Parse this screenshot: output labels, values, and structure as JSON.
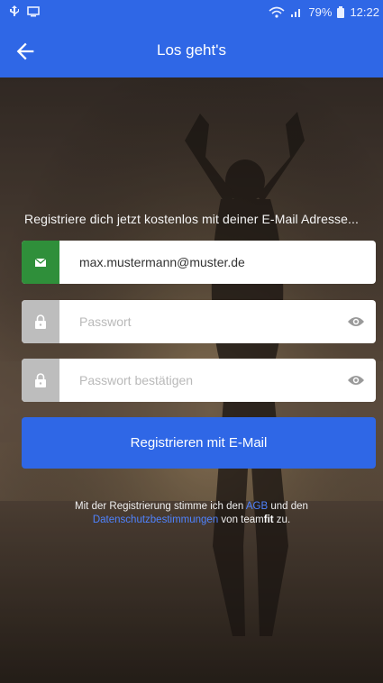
{
  "status_bar": {
    "battery": "79%",
    "time": "12:22"
  },
  "app_bar": {
    "title": "Los geht's",
    "back_icon": "arrow-left-icon"
  },
  "intro": "Registriere dich jetzt kostenlos mit deiner E-Mail Adresse...",
  "form": {
    "email_value": "max.mustermann@muster.de",
    "password_placeholder": "Passwort",
    "password_confirm_placeholder": "Passwort bestätigen",
    "submit_label": "Registrieren mit E-Mail"
  },
  "legal": {
    "text_before": "Mit der Registrierung stimme ich den",
    "agb_link": "AGB",
    "text_mid": "und den",
    "privacy_link": "Datenschutzbestimmungen",
    "text_before_brand": "von team",
    "brand": "fit",
    "text_end": "zu."
  },
  "colors": {
    "primary": "#2f67e6",
    "email_icon_bg": "#2f8f3a",
    "lock_icon_bg": "#bdbdbd"
  }
}
